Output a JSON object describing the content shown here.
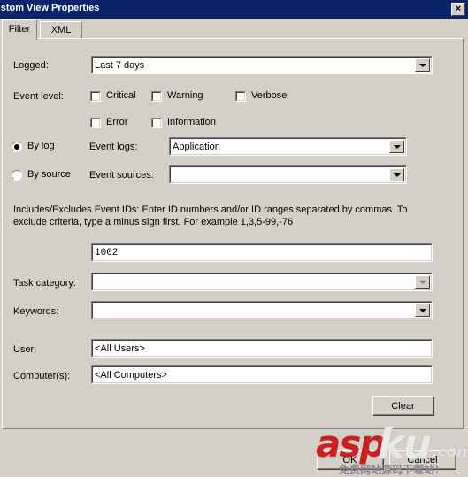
{
  "window": {
    "title": "ustom View Properties",
    "close_label": "×"
  },
  "tabs": [
    {
      "id": "filter",
      "label": "Filter",
      "active": true
    },
    {
      "id": "xml",
      "label": "XML",
      "active": false
    }
  ],
  "filter": {
    "logged": {
      "label": "Logged:",
      "value": "Last 7 days"
    },
    "event_level": {
      "label": "Event level:",
      "options": [
        {
          "label": "Critical",
          "checked": false
        },
        {
          "label": "Warning",
          "checked": false
        },
        {
          "label": "Verbose",
          "checked": false
        },
        {
          "label": "Error",
          "checked": false
        },
        {
          "label": "Information",
          "checked": false
        }
      ]
    },
    "by_log_radio": {
      "label": "By log",
      "selected": true
    },
    "by_source_radio": {
      "label": "By source",
      "selected": false
    },
    "event_logs": {
      "label": "Event logs:",
      "value": "Application"
    },
    "event_sources": {
      "label": "Event sources:",
      "value": ""
    },
    "event_ids": {
      "help_line1": "Includes/Excludes Event IDs: Enter ID numbers and/or ID ranges separated by commas. To",
      "help_line2": "exclude criteria, type a minus sign first. For example 1,3,5-99,-76",
      "value": "1002"
    },
    "task_category": {
      "label": "Task category:",
      "value": "",
      "disabled": true
    },
    "keywords": {
      "label": "Keywords:",
      "value": ""
    },
    "user": {
      "label": "User:",
      "value": "<All Users>"
    },
    "computers": {
      "label": "Computer(s):",
      "value": "<All Computers>"
    },
    "clear_button": "Clear"
  },
  "footer": {
    "ok_button": "OK",
    "cancel_button": "Cancel"
  },
  "watermark": {
    "part_red": "asp",
    "part_grey": "ku",
    "part_com": ".com",
    "tagline": "免费网站源码下载站！"
  },
  "colors": {
    "titlebar": "#0a246a",
    "face": "#d4d0c8",
    "field": "#ffffff",
    "watermark_red": "#cc1f1f"
  }
}
